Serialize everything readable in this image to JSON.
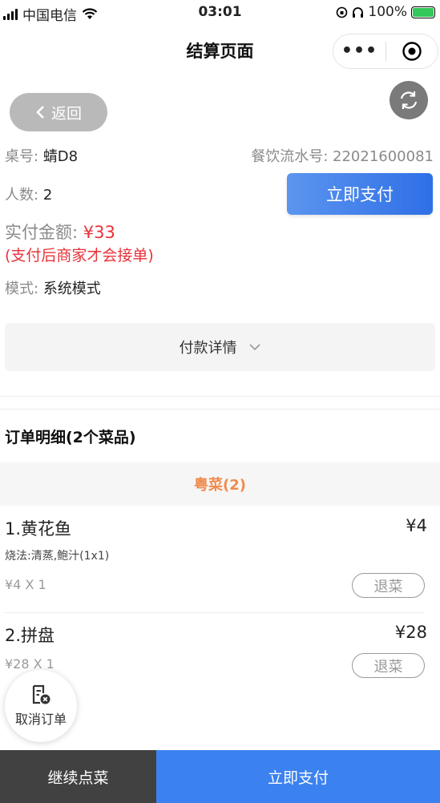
{
  "status_bar": {
    "carrier": "中国电信",
    "time": "03:01",
    "battery": "100%"
  },
  "nav": {
    "title": "结算页面",
    "more": "•••"
  },
  "back": {
    "label": "返回"
  },
  "order_info": {
    "table_label": "桌号:",
    "table_value": "蜻D8",
    "serial_label": "餐饮流水号:",
    "serial_value": "22021600081",
    "people_label": "人数:",
    "people_value": "2",
    "amount_label": "实付金额:",
    "amount_value": "¥33",
    "notice": "(支付后商家才会接单)",
    "mode_label": "模式:",
    "mode_value": "系统模式"
  },
  "pay_now_label": "立即支付",
  "pay_detail_label": "付款详情",
  "order_section": {
    "title": "订单明细(2个菜品)",
    "category": "粤菜(2)",
    "items": [
      {
        "name": "1.黄花鱼",
        "price": "¥4",
        "method": "烧法:清蒸,鲍汁(1x1)",
        "qty": "¥4 X 1",
        "refund": "退菜"
      },
      {
        "name": "2.拼盘",
        "price": "¥28",
        "qty": "¥28 X 1",
        "refund": "退菜"
      }
    ]
  },
  "cancel_order_label": "取消订单",
  "bottom_bar": {
    "continue_label": "继续点菜",
    "pay_label": "立即支付"
  },
  "colors": {
    "accent_blue": "#3b82f0",
    "price_red": "#e8323a",
    "category_orange": "#f08a4b"
  }
}
